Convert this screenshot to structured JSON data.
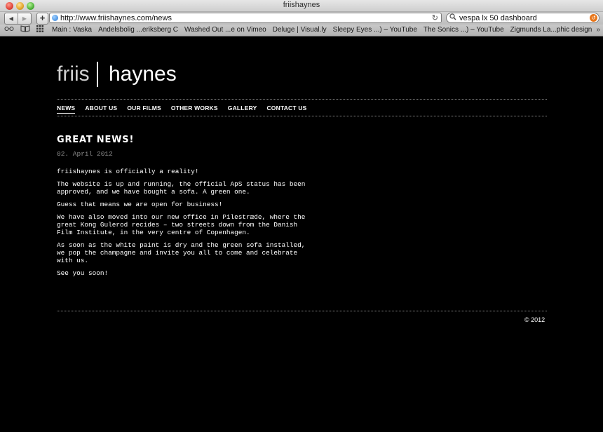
{
  "window": {
    "title": "friishaynes"
  },
  "toolbar": {
    "back_icon": "◀",
    "forward_icon": "▶",
    "add_icon": "+",
    "url": "http://www.friishaynes.com/news",
    "reload_icon": "↻",
    "search_query": "vespa lx 50 dashboard"
  },
  "bookmarks": {
    "items": [
      "Main : Vaska",
      "Andelsbolig ...eriksberg C",
      "Washed Out ...e on Vimeo",
      "Deluge | Visual.ly",
      "Sleepy Eyes ...) – YouTube",
      "The Sonics ...) – YouTube",
      "Zigmunds La...phic design"
    ],
    "more_icon": "»"
  },
  "site": {
    "logo_left": "friis",
    "logo_right": "haynes",
    "nav": [
      {
        "label": "NEWS",
        "active": true
      },
      {
        "label": "ABOUT US",
        "active": false
      },
      {
        "label": "OUR FILMS",
        "active": false
      },
      {
        "label": "OTHER WORKS",
        "active": false
      },
      {
        "label": "GALLERY",
        "active": false
      },
      {
        "label": "CONTACT US",
        "active": false
      }
    ],
    "headline": "GREAT NEWS!",
    "date": "02. April 2012",
    "paragraphs": [
      "friishaynes is officially a reality!",
      "The website is up and running, the official ApS status has been approved, and we have bought a sofa. A green one.",
      "Guess that means we are open for business!",
      "We have also moved into our new office in Pilestræde, where the great Kong Gulerod recides – two streets down from the Danish Film Institute, in the very centre of Copenhagen.",
      "As soon as the white paint is dry and the green sofa installed, we pop the champagne and invite you all to come and celebrate with us.",
      "See you soon!"
    ],
    "copyright": "© 2012"
  },
  "colors": {
    "page_bg": "#000000",
    "text": "#ffffff",
    "date": "#8c8c8c",
    "snapback": "#e8761a"
  }
}
